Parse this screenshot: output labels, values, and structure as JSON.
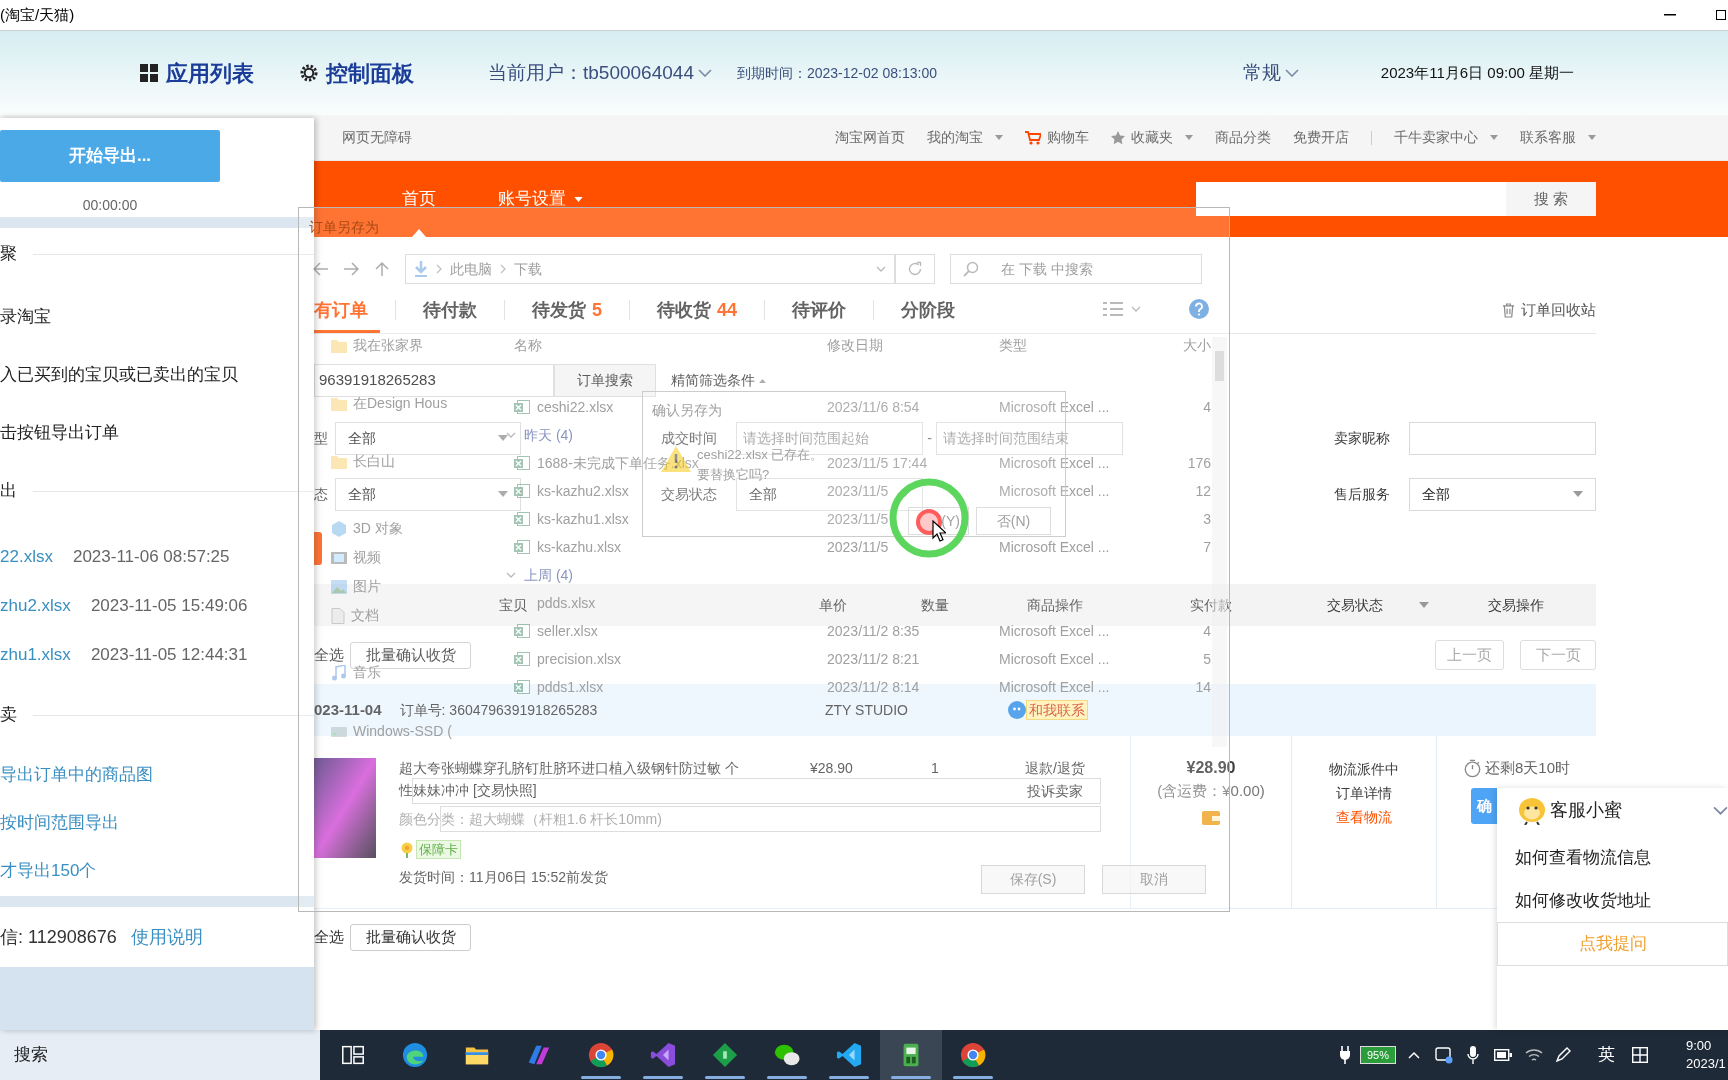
{
  "window": {
    "title": "(淘宝/天猫)"
  },
  "app_header": {
    "app_list": "应用列表",
    "control_panel": "控制面板",
    "current_user": "当前用户：tb500064044",
    "expiry": "到期时间：2023-12-02 08:13:00",
    "mode": "常规",
    "datetime": "2023年11月6日 09:00 星期一"
  },
  "left_panel": {
    "export_button": "开始导出...",
    "timer": "00:00:00",
    "sections": [
      {
        "kind": "steps",
        "heading": "聚",
        "items": [
          "录淘宝",
          "入已买到的宝贝或已卖出的宝贝",
          "击按钮导出订单"
        ]
      },
      {
        "kind": "files",
        "heading": "出",
        "items": [
          {
            "name": "22.xlsx",
            "time": "2023-11-06 08:57:25"
          },
          {
            "name": "zhu2.xlsx",
            "time": "2023-11-05 15:49:06"
          },
          {
            "name": "zhu1.xlsx",
            "time": "2023-11-05 12:44:31"
          }
        ]
      },
      {
        "kind": "links",
        "heading": "卖",
        "items": [
          "导出订单中的商品图",
          "按时间范围导出",
          "才导出150个"
        ]
      }
    ],
    "contact": "信: 112908676",
    "help_link": "使用说明"
  },
  "site_nav": {
    "left": "网页无障碍",
    "items": [
      {
        "kind": "link",
        "label": "淘宝网首页",
        "dropdown": false
      },
      {
        "kind": "link",
        "label": "我的淘宝",
        "dropdown": true
      },
      {
        "kind": "cart",
        "label": "购物车",
        "dropdown": false
      },
      {
        "kind": "star",
        "label": "收藏夹",
        "dropdown": true
      },
      {
        "kind": "link",
        "label": "商品分类",
        "dropdown": false
      },
      {
        "kind": "link",
        "label": "免费开店",
        "dropdown": false
      },
      {
        "kind": "link",
        "label": "千牛卖家中心",
        "dropdown": true,
        "separator_before": true
      },
      {
        "kind": "link",
        "label": "联系客服",
        "dropdown": true
      }
    ]
  },
  "header_bar": {
    "nav": [
      {
        "label": "首页",
        "selected": true,
        "dropdown": false
      },
      {
        "label": "账号设置",
        "selected": false,
        "dropdown": true
      }
    ],
    "search_button": "搜 索"
  },
  "order_tabs": [
    {
      "label": "有订单",
      "selected": true
    },
    {
      "label": "待付款",
      "selected": false
    },
    {
      "label": "待发货",
      "count": "5",
      "selected": false
    },
    {
      "label": "待收货",
      "count": "44",
      "selected": false
    },
    {
      "label": "待评价",
      "selected": false
    },
    {
      "label": "分阶段",
      "selected": false
    }
  ],
  "recycle_bin": "订单回收站",
  "order_search": {
    "value": "96391918265283",
    "button": "订单搜索",
    "toggle": "精简筛选条件"
  },
  "filter_rows": [
    [
      {
        "label": "型",
        "kind": "select",
        "value": "全部"
      },
      {
        "label": "成交时间",
        "kind": "range",
        "start_placeholder": "请选择时间范围起始",
        "separator": "-",
        "end_placeholder": "请选择时间范围结束"
      },
      {
        "label": "卖家昵称",
        "kind": "input"
      }
    ],
    [
      {
        "label": "态",
        "kind": "select",
        "value": "全部"
      },
      {
        "label": "交易状态",
        "kind": "select",
        "value": "全部"
      },
      {
        "label": "售后服务",
        "kind": "select",
        "value": "全部"
      }
    ]
  ],
  "table": {
    "columns": [
      {
        "label": "宝贝",
        "dropdown": false
      },
      {
        "label": "单价",
        "dropdown": false
      },
      {
        "label": "数量",
        "dropdown": false
      },
      {
        "label": "商品操作",
        "dropdown": false
      },
      {
        "label": "实付款",
        "dropdown": false
      },
      {
        "label": "交易状态",
        "dropdown": true
      },
      {
        "label": "交易操作",
        "dropdown": false
      }
    ]
  },
  "top_actions": {
    "select_all": "全选",
    "batch_button": "批量确认收货",
    "prev_page": "上一页",
    "next_page": "下一页"
  },
  "order": {
    "date": "023-11-04",
    "order_no": "订单号: 3604796391918265283",
    "shop": "ZTY STUDIO",
    "contact": "和我联系",
    "item": {
      "title": "超大夸张蝴蝶穿孔脐钉肚脐环进口植入级钢针防过敏 个性妹妹冲冲",
      "snapshot": "[交易快照]",
      "spec": "颜色分类：超大蝴蝶（杆粗1.6 杆长10mm)",
      "guarantee": "保障卡",
      "ship_time": "发货时间：11月06日 15:52前发货"
    },
    "price": "¥28.90",
    "quantity": "1",
    "item_actions": [
      "退款/退货",
      "投诉卖家"
    ],
    "paid": "¥28.90",
    "shipping_note": "(含运费：¥0.00)",
    "status_lines": [
      {
        "kind": "text",
        "label": "物流派件中"
      },
      {
        "kind": "link",
        "label": "订单详情"
      },
      {
        "kind": "highlight",
        "label": "查看物流"
      }
    ],
    "countdown": "还剩8天10时",
    "confirm_button": "确"
  },
  "bottom_actions": {
    "select_all": "全选",
    "batch_button": "批量确认收货"
  },
  "save_dialog": {
    "title": "订单另存为",
    "path": [
      "此电脑",
      "下载"
    ],
    "search_placeholder": "在 下载 中搜索",
    "nav_items": [
      {
        "kind": "folder",
        "label": "我在张家界"
      },
      {
        "kind": "folder",
        "label": "在Design Hous"
      },
      {
        "kind": "folder",
        "label": "长白山"
      },
      {
        "kind": "cube",
        "label": "3D 对象"
      },
      {
        "kind": "video",
        "label": "视频"
      },
      {
        "kind": "picture",
        "label": "图片"
      },
      {
        "kind": "document",
        "label": "文档"
      },
      {
        "kind": "music",
        "label": "音乐"
      },
      {
        "kind": "drive",
        "label": "Windows-SSD ("
      }
    ],
    "columns": [
      "名称",
      "修改日期",
      "类型",
      "大小"
    ],
    "groups": [
      {
        "files": [
          {
            "kind": "excel",
            "name": "ceshi22.xlsx",
            "modified": "2023/11/6 8:54",
            "type": "Microsoft Excel ...",
            "size": "4"
          }
        ]
      },
      {
        "label": "昨天 (4)",
        "files": [
          {
            "kind": "excel",
            "name": "1688-未完成下单任务.xlsx",
            "modified": "2023/11/5 17:44",
            "type": "Microsoft Excel ...",
            "size": "176"
          },
          {
            "kind": "excel",
            "name": "ks-kazhu2.xlsx",
            "modified": "2023/11/5",
            "type": "Microsoft Excel ...",
            "size": "12"
          },
          {
            "kind": "excel",
            "name": "ks-kazhu1.xlsx",
            "modified": "2023/11/5",
            "size": "3"
          },
          {
            "kind": "excel",
            "name": "ks-kazhu.xlsx",
            "modified": "2023/11/5",
            "type": "Microsoft Excel ...",
            "size": "7"
          }
        ]
      },
      {
        "label": "上周 (4)",
        "files": [
          {
            "kind": "covered",
            "name": "pdds.xlsx"
          },
          {
            "kind": "excel",
            "name": "seller.xlsx",
            "modified": "2023/11/2 8:35",
            "type": "Microsoft Excel ...",
            "size": "4"
          },
          {
            "kind": "excel",
            "name": "precision.xlsx",
            "modified": "2023/11/2 8:21",
            "type": "Microsoft Excel ...",
            "size": "5"
          },
          {
            "kind": "excel",
            "name": "pdds1.xlsx",
            "modified": "2023/11/2 8:14",
            "type": "Microsoft Excel ...",
            "size": "14"
          }
        ]
      }
    ],
    "buttons": [
      "保存(S)",
      "取消"
    ]
  },
  "confirm_dialog": {
    "title": "确认另存为",
    "message": [
      "ceshi22.xlsx 已存在。",
      "要替换它吗?"
    ],
    "buttons": [
      "(Y)",
      "否(N)"
    ]
  },
  "service_widget": {
    "title": "客服小蜜",
    "questions": [
      "如何查看物流信息",
      "如何修改收货地址"
    ],
    "ask_button": "点我提问"
  },
  "taskbar": {
    "search": "搜索",
    "apps": [
      {
        "kind": "taskview",
        "running": false,
        "active": false
      },
      {
        "kind": "edge",
        "running": false,
        "active": false
      },
      {
        "kind": "explorer",
        "running": false,
        "active": false
      },
      {
        "kind": "copilot",
        "running": false,
        "active": false
      },
      {
        "kind": "chrome",
        "running": true,
        "active": false
      },
      {
        "kind": "studio",
        "running": true,
        "active": false
      },
      {
        "kind": "diamond",
        "running": true,
        "active": false
      },
      {
        "kind": "wechat",
        "running": true,
        "active": false
      },
      {
        "kind": "vscode",
        "running": true,
        "active": false
      },
      {
        "kind": "exporter",
        "running": true,
        "active": true
      },
      {
        "kind": "chrome",
        "running": true,
        "active": false
      }
    ],
    "battery": "95%",
    "ime": "英",
    "time": "9:00",
    "date": "2023/1"
  }
}
